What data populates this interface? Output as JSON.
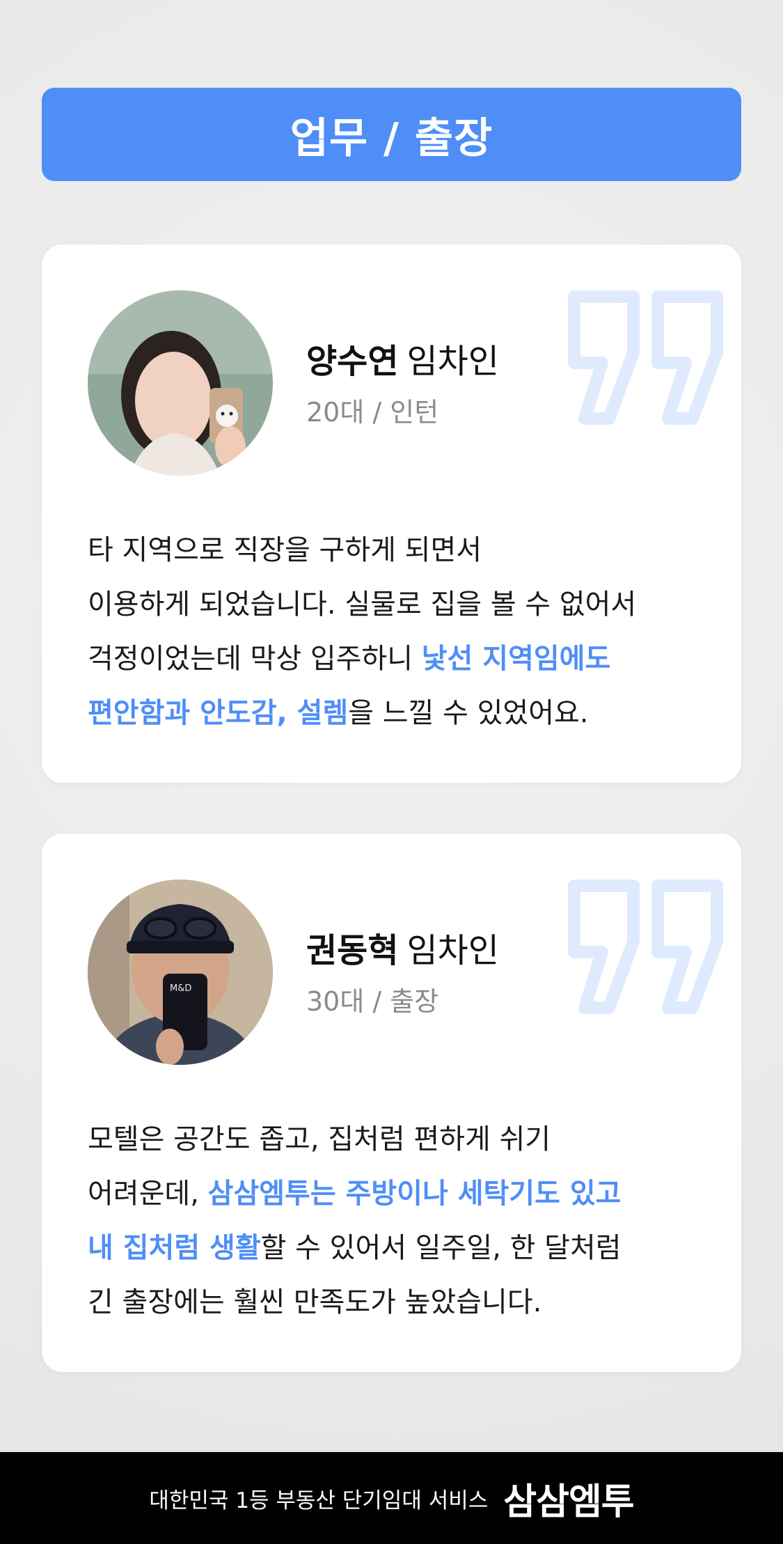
{
  "header": {
    "title": "업무 / 출장"
  },
  "reviews": [
    {
      "name": "양수연",
      "role": "임차인",
      "meta": "20대 / 인턴",
      "lines": [
        {
          "a": "타 지역으로 직장을 구하게 되면서",
          "hl": "",
          "b": ""
        },
        {
          "a": "이용하게 되었습니다. 실물로 집을 볼 수 없어서",
          "hl": "",
          "b": ""
        },
        {
          "a": "걱정이었는데 막상 입주하니 ",
          "hl": "낯선 지역임에도",
          "b": ""
        },
        {
          "a": "",
          "hl": "편안함과 안도감, 설렘",
          "b": "을 느낄 수 있었어요."
        }
      ]
    },
    {
      "name": "권동혁",
      "role": "임차인",
      "meta": "30대 / 출장",
      "lines": [
        {
          "a": "모텔은 공간도 좁고, 집처럼 편하게 쉬기",
          "hl": "",
          "b": ""
        },
        {
          "a": "어려운데, ",
          "hl": "삼삼엠투는 주방이나 세탁기도 있고",
          "b": ""
        },
        {
          "a": "",
          "hl": "내 집처럼 생활",
          "b": "할 수 있어서 일주일, 한 달처럼"
        },
        {
          "a": "긴 출장에는 훨씬 만족도가 높았습니다.",
          "hl": "",
          "b": ""
        }
      ]
    }
  ],
  "footer": {
    "tagline": "대한민국 1등 부동산 단기임대 서비스",
    "logo": "삼삼엠투"
  },
  "colors": {
    "accent": "#4f8ef7",
    "background": "#ececec",
    "card": "#ffffff",
    "footer": "#000000"
  },
  "icons": {
    "quote": "quote-mark-icon",
    "avatar": "avatar-photo"
  }
}
